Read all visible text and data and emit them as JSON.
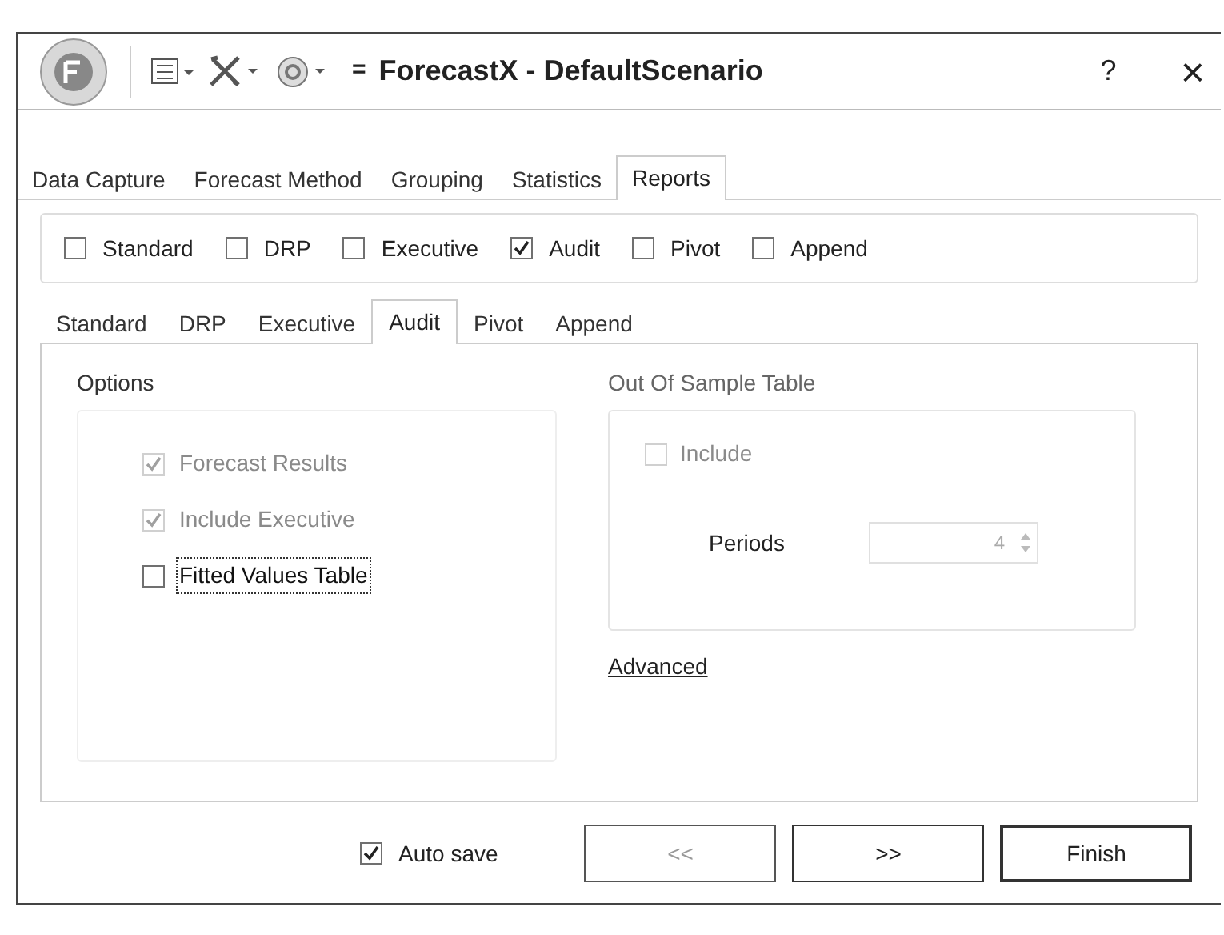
{
  "window": {
    "title": "ForecastX - DefaultScenario",
    "help": "?",
    "close": "×",
    "quick_access": "="
  },
  "tabs": [
    {
      "label": "Data Capture",
      "selected": false
    },
    {
      "label": "Forecast Method",
      "selected": false
    },
    {
      "label": "Grouping",
      "selected": false
    },
    {
      "label": "Statistics",
      "selected": false
    },
    {
      "label": "Reports",
      "selected": true
    }
  ],
  "report_types": [
    {
      "label": "Standard",
      "checked": false
    },
    {
      "label": "DRP",
      "checked": false
    },
    {
      "label": "Executive",
      "checked": false
    },
    {
      "label": "Audit",
      "checked": true
    },
    {
      "label": "Pivot",
      "checked": false
    },
    {
      "label": "Append",
      "checked": false
    }
  ],
  "report_tabs": [
    {
      "label": "Standard",
      "selected": false
    },
    {
      "label": "DRP",
      "selected": false
    },
    {
      "label": "Executive",
      "selected": false
    },
    {
      "label": "Audit",
      "selected": true
    },
    {
      "label": "Pivot",
      "selected": false
    },
    {
      "label": "Append",
      "selected": false
    }
  ],
  "options": {
    "title": "Options",
    "items": [
      {
        "label": "Forecast Results",
        "checked": true,
        "disabled": true,
        "focused": false
      },
      {
        "label": "Include Executive",
        "checked": true,
        "disabled": true,
        "focused": false
      },
      {
        "label": "Fitted Values Table",
        "checked": false,
        "disabled": false,
        "focused": true
      }
    ]
  },
  "out_of_sample": {
    "title": "Out Of  Sample Table",
    "include": {
      "label": "Include",
      "checked": false,
      "disabled": true
    },
    "periods_label": "Periods",
    "periods_value": "4",
    "disabled": true
  },
  "advanced_link": "Advanced",
  "auto_save": {
    "label": "Auto save",
    "checked": true
  },
  "buttons": [
    {
      "label": "<<",
      "disabled": true
    },
    {
      "label": ">>",
      "disabled": false
    },
    {
      "label": "Finish",
      "disabled": false
    }
  ]
}
